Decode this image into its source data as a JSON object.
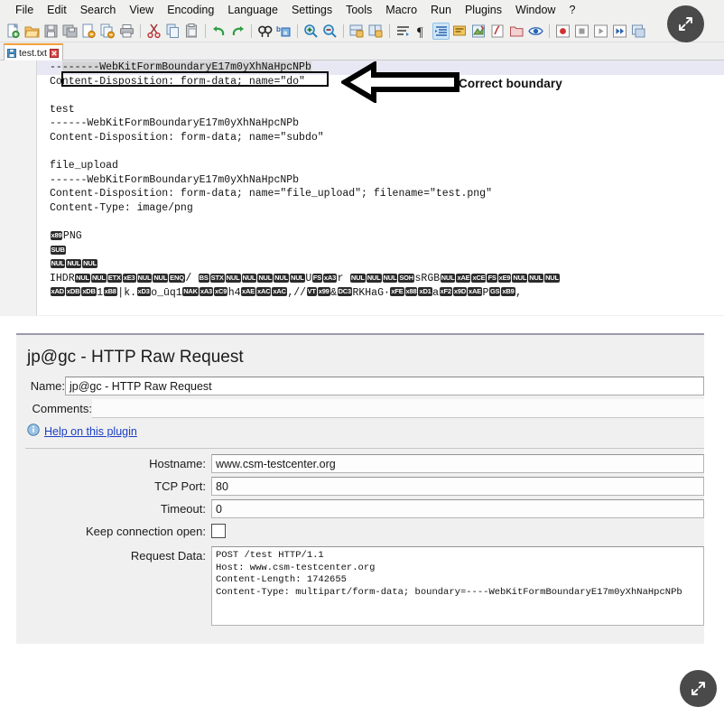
{
  "npp": {
    "menu": [
      "File",
      "Edit",
      "Search",
      "View",
      "Encoding",
      "Language",
      "Settings",
      "Tools",
      "Macro",
      "Run",
      "Plugins",
      "Window",
      "?"
    ],
    "tab": {
      "filename": "test.txt",
      "icon": "save-file-icon",
      "close_icon": "close-icon"
    },
    "toolbar_icons": [
      "new-file-icon",
      "open-file-icon",
      "save-icon",
      "save-all-icon",
      "close-file-icon",
      "close-all-icon",
      "print-icon",
      "cut-icon",
      "copy-icon",
      "paste-icon",
      "undo-icon",
      "redo-icon",
      "find-icon",
      "replace-icon",
      "zoom-in-icon",
      "zoom-out-icon",
      "sync-vertical-icon",
      "sync-horizontal-icon",
      "word-wrap-icon",
      "pilcrow-icon",
      "all-chars-icon",
      "indent-guide-icon",
      "user-language-icon",
      "doc-map-icon",
      "function-list-icon",
      "folder-workspace-icon",
      "monitoring-icon",
      "record-macro-icon",
      "stop-macro-icon",
      "play-macro-icon",
      "run-macro-multiple-icon",
      "save-macro-icon",
      "spellcheck-icon"
    ],
    "lines": [
      {
        "n": "1",
        "selected": true,
        "segments": [
          {
            "t": "text",
            "v": "--"
          },
          {
            "t": "sel",
            "v": "------WebKitFormBoundaryE17m0yXhNaHpcNPb"
          }
        ]
      },
      {
        "n": "2",
        "segments": [
          {
            "t": "text",
            "v": "Content-Disposition: form-data; name=\"do\""
          }
        ]
      },
      {
        "n": "3",
        "segments": []
      },
      {
        "n": "4",
        "segments": [
          {
            "t": "text",
            "v": "test"
          }
        ]
      },
      {
        "n": "5",
        "segments": [
          {
            "t": "text",
            "v": "------WebKitFormBoundaryE17m0yXhNaHpcNPb"
          }
        ]
      },
      {
        "n": "6",
        "segments": [
          {
            "t": "text",
            "v": "Content-Disposition: form-data; name=\"subdo\""
          }
        ]
      },
      {
        "n": "7",
        "segments": []
      },
      {
        "n": "8",
        "segments": [
          {
            "t": "text",
            "v": "file_upload"
          }
        ]
      },
      {
        "n": "9",
        "segments": [
          {
            "t": "text",
            "v": "------WebKitFormBoundaryE17m0yXhNaHpcNPb"
          }
        ]
      },
      {
        "n": "10",
        "segments": [
          {
            "t": "text",
            "v": "Content-Disposition: form-data; name=\"file_upload\"; filename=\"test.png\""
          }
        ]
      },
      {
        "n": "11",
        "segments": [
          {
            "t": "text",
            "v": "Content-Type: image/png"
          }
        ]
      },
      {
        "n": "12",
        "segments": []
      },
      {
        "n": "13",
        "segments": [
          {
            "t": "cc",
            "v": "x89"
          },
          {
            "t": "text",
            "v": "PNG"
          }
        ]
      },
      {
        "n": "14",
        "segments": [
          {
            "t": "cc",
            "v": "SUB"
          }
        ]
      },
      {
        "n": "15",
        "segments": [
          {
            "t": "cc",
            "v": "NUL"
          },
          {
            "t": "cc",
            "v": "NUL"
          },
          {
            "t": "cc",
            "v": "NUL"
          }
        ]
      },
      {
        "n": "16",
        "segments": [
          {
            "t": "text",
            "v": "IHDR"
          },
          {
            "t": "cc",
            "v": "NUL"
          },
          {
            "t": "cc",
            "v": "NUL"
          },
          {
            "t": "cc",
            "v": "ETX"
          },
          {
            "t": "cc",
            "v": "xE3"
          },
          {
            "t": "cc",
            "v": "NUL"
          },
          {
            "t": "cc",
            "v": "NUL"
          },
          {
            "t": "cc",
            "v": "ENQ"
          },
          {
            "t": "text",
            "v": "/ "
          },
          {
            "t": "cc",
            "v": "BS"
          },
          {
            "t": "cc",
            "v": "STX"
          },
          {
            "t": "cc",
            "v": "NUL"
          },
          {
            "t": "cc",
            "v": "NUL"
          },
          {
            "t": "cc",
            "v": "NUL"
          },
          {
            "t": "cc",
            "v": "NUL"
          },
          {
            "t": "cc",
            "v": "NUL"
          },
          {
            "t": "text",
            "v": "U"
          },
          {
            "t": "cc",
            "v": "FS"
          },
          {
            "t": "cc",
            "v": "xA3"
          },
          {
            "t": "text",
            "v": "r "
          },
          {
            "t": "cc",
            "v": "NUL"
          },
          {
            "t": "cc",
            "v": "NUL"
          },
          {
            "t": "cc",
            "v": "NUL"
          },
          {
            "t": "cc",
            "v": "SOH"
          },
          {
            "t": "text",
            "v": "sRGB"
          },
          {
            "t": "cc",
            "v": "NUL"
          },
          {
            "t": "cc",
            "v": "xAE"
          },
          {
            "t": "cc",
            "v": "xCE"
          },
          {
            "t": "cc",
            "v": "FS"
          },
          {
            "t": "cc",
            "v": "xE9"
          },
          {
            "t": "cc",
            "v": "NUL"
          },
          {
            "t": "cc",
            "v": "NUL"
          },
          {
            "t": "cc",
            "v": "NUL"
          }
        ]
      },
      {
        "n": "17",
        "segments": [
          {
            "t": "cc",
            "v": "xAD"
          },
          {
            "t": "cc",
            "v": "xDB"
          },
          {
            "t": "cc",
            "v": "xDB"
          },
          {
            "t": "text",
            "v": "1"
          },
          {
            "t": "cc",
            "v": "xB8"
          },
          {
            "t": "text",
            "v": "|k."
          },
          {
            "t": "cc",
            "v": "xD3"
          },
          {
            "t": "text",
            "v": "o_ūq1"
          },
          {
            "t": "cc",
            "v": "NAK"
          },
          {
            "t": "cc",
            "v": "xA3"
          },
          {
            "t": "cc",
            "v": "xC9"
          },
          {
            "t": "text",
            "v": "h4"
          },
          {
            "t": "cc",
            "v": "xAE"
          },
          {
            "t": "cc",
            "v": "xAC"
          },
          {
            "t": "cc",
            "v": "xAC"
          },
          {
            "t": "text",
            "v": ",//"
          },
          {
            "t": "cc",
            "v": "VT"
          },
          {
            "t": "cc",
            "v": "x99"
          },
          {
            "t": "text",
            "v": "&"
          },
          {
            "t": "cc",
            "v": "DC3"
          },
          {
            "t": "text",
            "v": "RKHaG·"
          },
          {
            "t": "cc",
            "v": "xFE"
          },
          {
            "t": "cc",
            "v": "x88"
          },
          {
            "t": "cc",
            "v": "xD1"
          },
          {
            "t": "text",
            "v": "a"
          },
          {
            "t": "cc",
            "v": "xF2"
          },
          {
            "t": "cc",
            "v": "x9D"
          },
          {
            "t": "cc",
            "v": "xAE"
          },
          {
            "t": "text",
            "v": "P"
          },
          {
            "t": "cc",
            "v": "GS"
          },
          {
            "t": "cc",
            "v": "xB9"
          },
          {
            "t": "text",
            "v": ","
          }
        ]
      }
    ]
  },
  "annotation": {
    "label": "Correct boundary",
    "arrow_icon": "left-block-arrow-icon",
    "box_icon": "highlight-rectangle"
  },
  "expand_buttons": {
    "icon": "expand-diagonal-arrows-icon",
    "npp_label": "",
    "dialog_label": ""
  },
  "dialog": {
    "title": "jp@gc - HTTP Raw Request",
    "name_label": "Name:",
    "name_value": "jp@gc - HTTP Raw Request",
    "comments_label": "Comments:",
    "comments_value": "",
    "help_link": "Help on this plugin",
    "help_icon": "info-icon",
    "fields": [
      {
        "label": "Hostname:",
        "value": "www.csm-testcenter.org",
        "name": "hostname"
      },
      {
        "label": "TCP Port:",
        "value": "80",
        "name": "tcp-port"
      },
      {
        "label": "Timeout:",
        "value": "0",
        "name": "timeout"
      }
    ],
    "keep_open_label": "Keep connection open:",
    "keep_open_checked": false,
    "request_data_label": "Request Data:",
    "request_data": [
      "POST /test HTTP/1.1",
      "Host: www.csm-testcenter.org",
      "Content-Length: 1742655",
      "Content-Type: multipart/form-data; boundary=----WebKitFormBoundaryE17m0yXhNaHpcNPb"
    ]
  },
  "colors": {
    "tab_accent": "#f5a03c",
    "selection": "#d4d4d4",
    "selected_line": "#e8e8f4",
    "link": "#1c3fc4",
    "expand_button": "#4a4a4a"
  }
}
